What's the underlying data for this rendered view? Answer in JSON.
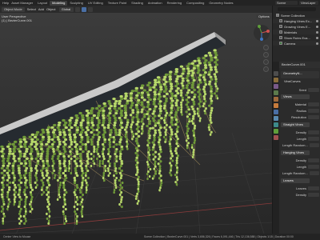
{
  "topbar": {
    "menus": [
      "Help",
      "Asset Manager",
      "Layout",
      "Modeling",
      "Sculpting",
      "UV Editing",
      "Texture Paint",
      "Shading",
      "Animation",
      "Rendering",
      "Compositing",
      "Geometry Nodes"
    ],
    "active_tab": "Modeling",
    "scene": "Scene",
    "view_layer": "ViewLayer"
  },
  "viewport_header": {
    "items": [
      "Select",
      "Add",
      "Object"
    ],
    "mode": "Object Mode",
    "orientation": "Global",
    "options": "Options"
  },
  "viewport_info": {
    "line1": "User Perspective",
    "line2": "(1) | BezierCurve.001"
  },
  "outliner": {
    "rows": [
      {
        "label": "Scene Collection"
      },
      {
        "label": "Hanging Vines Ex..."
      },
      {
        "label": "Growing Vines E..."
      },
      {
        "label": "Materials"
      },
      {
        "label": "Show Ruins Exa..."
      },
      {
        "label": "Camera"
      }
    ]
  },
  "properties": {
    "header": "BezierCurve.001",
    "node1": "GeometryN...",
    "node2": "VineCurves",
    "seed_label": "Seed",
    "views_label": "Views",
    "fields": [
      "Material",
      "Radius",
      "Resolution"
    ],
    "straight_vines": "Straight Vines",
    "fields2": [
      "Density",
      "Length",
      "Length Random..."
    ],
    "hanging_vines": "Hanging Vines",
    "fields3": [
      "Density",
      "Length",
      "Length Random..."
    ],
    "leaves_label": "Leaves",
    "fields4": [
      "Leaves",
      "Density"
    ]
  },
  "statusbar": {
    "hint": "Center View to Mouse",
    "stats": "Scene Collection | BezierCurve.001 | Verts 3,656,326 | Faces 6,091,446 | Tris 12,136,588 | Objects 1/15 | Duration 00:00"
  },
  "colors": {
    "leaf_light": "#b7d96a",
    "leaf_dark": "#6f9a38",
    "vine": "#8b7a52",
    "structure_top": "#c9c9c9",
    "structure_side": "#262b30",
    "accent": "#4a6fa5"
  }
}
